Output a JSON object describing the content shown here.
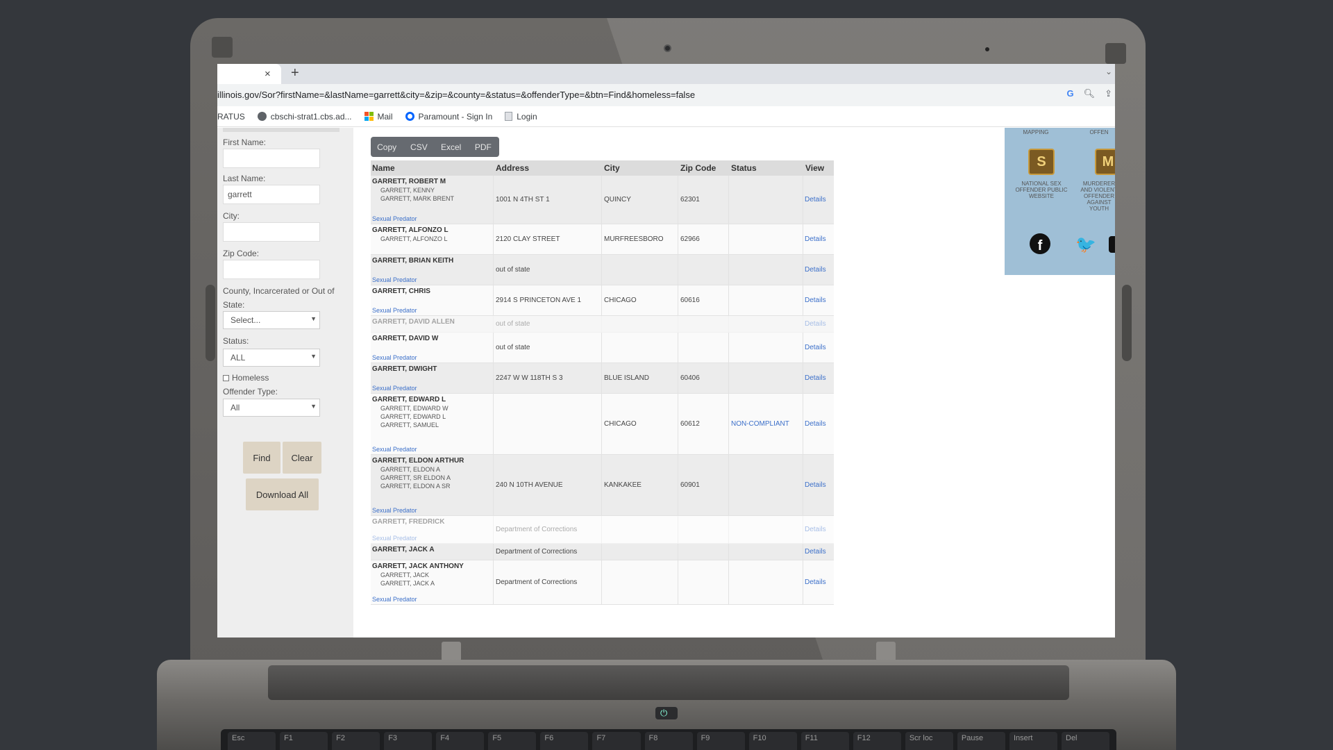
{
  "browser": {
    "tab_close": "×",
    "new_tab": "+",
    "url": "illinois.gov/Sor?firstName=&lastName=garrett&city=&zip=&county=&status=&offenderType=&btn=Find&homeless=false",
    "bookmarks": [
      {
        "label": "RATUS",
        "color": "#ffffff"
      },
      {
        "label": "cbschi-strat1.cbs.ad...",
        "color": "#5f6368"
      },
      {
        "label": "Mail",
        "color": "#f35325"
      },
      {
        "label": "Paramount - Sign In",
        "color": "#0064ff"
      },
      {
        "label": "Login",
        "color": "#9aa0a6"
      }
    ]
  },
  "form": {
    "first_name_label": "First Name:",
    "first_name_value": "",
    "last_name_label": "Last Name:",
    "last_name_value": "garrett",
    "city_label": "City:",
    "city_value": "",
    "zip_label": "Zip Code:",
    "zip_value": "",
    "county_label_1": "County, Incarcerated or Out of",
    "county_label_2": "State:",
    "county_value": "Select...",
    "status_label": "Status:",
    "status_value": "ALL",
    "homeless_label": "Homeless",
    "offender_type_label": "Offender Type:",
    "offender_type_value": "All",
    "find_button": "Find",
    "clear_button": "Clear",
    "download_button": "Download All"
  },
  "export_buttons": [
    "Copy",
    "CSV",
    "Excel",
    "PDF"
  ],
  "table": {
    "headers": [
      "Name",
      "Address",
      "City",
      "Zip Code",
      "Status",
      "View"
    ],
    "rows": [
      {
        "name": "GARRETT, ROBERT M",
        "aliases": [
          "GARRETT, KENNY",
          "GARRETT, MARK BRENT"
        ],
        "tag": "Sexual Predator",
        "address": "1001 N 4TH ST 1",
        "city": "QUINCY",
        "zip": "62301",
        "status": "",
        "view": "Details"
      },
      {
        "name": "GARRETT, ALFONZO L",
        "aliases": [
          "GARRETT, ALFONZO L"
        ],
        "tag": "",
        "address": "2120 CLAY STREET",
        "city": "MURFREESBORO",
        "zip": "62966",
        "status": "",
        "view": "Details"
      },
      {
        "name": "GARRETT, BRIAN KEITH",
        "aliases": [],
        "tag": "Sexual Predator",
        "address": "out of state",
        "city": "",
        "zip": "",
        "status": "",
        "view": "Details"
      },
      {
        "name": "GARRETT, CHRIS",
        "aliases": [],
        "tag": "Sexual Predator",
        "address": "2914 S PRINCETON AVE 1",
        "city": "CHICAGO",
        "zip": "60616",
        "status": "",
        "view": "Details"
      },
      {
        "name": "GARRETT, DAVID ALLEN",
        "aliases": [],
        "tag": "",
        "address": "out of state",
        "city": "",
        "zip": "",
        "status": "",
        "view": "Details"
      },
      {
        "name": "GARRETT, DAVID W",
        "aliases": [],
        "tag": "Sexual Predator",
        "address": "out of state",
        "city": "",
        "zip": "",
        "status": "",
        "view": "Details"
      },
      {
        "name": "GARRETT, DWIGHT",
        "aliases": [],
        "tag": "Sexual Predator",
        "address": "2247 W W 118TH S 3",
        "city": "BLUE ISLAND",
        "zip": "60406",
        "status": "",
        "view": "Details"
      },
      {
        "name": "GARRETT, EDWARD L",
        "aliases": [
          "GARRETT, EDWARD W",
          "GARRETT, EDWARD L",
          "GARRETT, SAMUEL"
        ],
        "tag": "Sexual Predator",
        "address": "",
        "city": "CHICAGO",
        "zip": "60612",
        "status": "NON-COMPLIANT",
        "view": "Details"
      },
      {
        "name": "GARRETT, ELDON ARTHUR",
        "aliases": [
          "GARRETT, ELDON A",
          "GARRETT, SR ELDON A",
          "GARRETT, ELDON A SR"
        ],
        "tag": "Sexual Predator",
        "address": "240 N 10TH AVENUE",
        "city": "KANKAKEE",
        "zip": "60901",
        "status": "",
        "view": "Details"
      },
      {
        "name": "GARRETT, FREDRICK",
        "aliases": [],
        "tag": "Sexual Predator",
        "address": "Department of Corrections",
        "city": "",
        "zip": "",
        "status": "",
        "view": "Details"
      },
      {
        "name": "GARRETT, JACK A",
        "aliases": [],
        "tag": "",
        "address": "Department of Corrections",
        "city": "",
        "zip": "",
        "status": "",
        "view": "Details"
      },
      {
        "name": "GARRETT, JACK ANTHONY",
        "aliases": [
          "GARRETT, JACK",
          "GARRETT, JACK A"
        ],
        "tag": "Sexual Predator",
        "address": "Department of Corrections",
        "city": "",
        "zip": "",
        "status": "",
        "view": "Details"
      }
    ]
  },
  "right_panel": {
    "caption_1_top": "MAPPING",
    "caption_1": "NATIONAL SEX OFFENDER PUBLIC WEBSITE",
    "caption_2_top": "OFFEN",
    "caption_2": "MURDERER AND VIOLENT OFFENDER AGAINST YOUTH",
    "icon_1": "S",
    "icon_2": "M",
    "facebook_glyph": "f",
    "twitter_glyph": "🐦"
  },
  "keyboard": [
    "Esc",
    "F1",
    "F2",
    "F3",
    "F4",
    "F5",
    "F6",
    "F7",
    "F8",
    "F9",
    "F10",
    "F11",
    "F12",
    "Scr loc",
    "Pause",
    "Insert",
    "Del"
  ],
  "colors": {
    "link": "#3b6fc9",
    "panel": "#9fbfd6",
    "button": "#ddd4c4"
  }
}
